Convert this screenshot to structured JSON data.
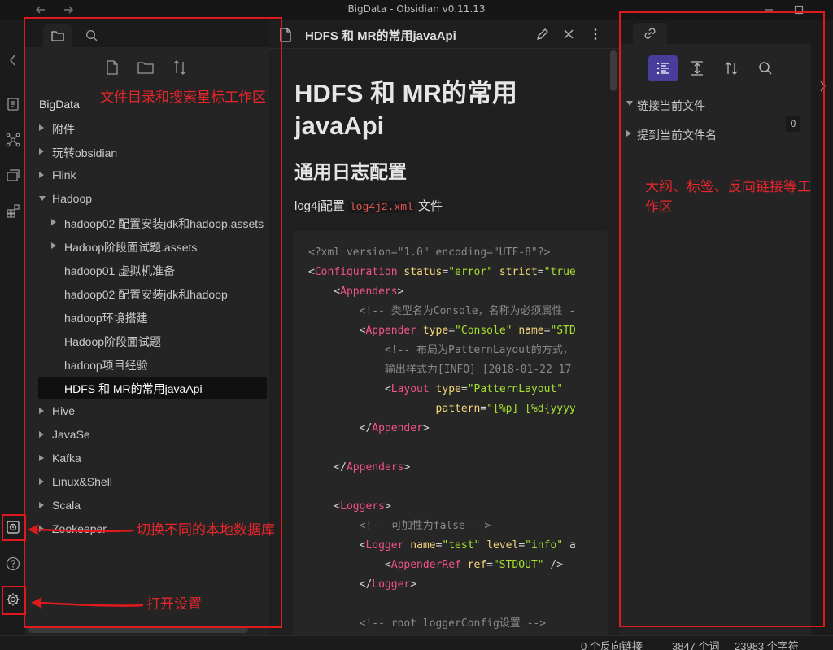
{
  "window": {
    "title": "BigData - Obsidian v0.11.13"
  },
  "vault": {
    "name": "BigData"
  },
  "file_tree": [
    {
      "label": "附件",
      "level": 0,
      "kind": "folder-closed"
    },
    {
      "label": "玩转obsidian",
      "level": 0,
      "kind": "folder-closed"
    },
    {
      "label": "Flink",
      "level": 0,
      "kind": "folder-closed"
    },
    {
      "label": "Hadoop",
      "level": 0,
      "kind": "folder-open"
    },
    {
      "label": "hadoop02 配置安装jdk和hadoop.assets",
      "level": 1,
      "kind": "folder-closed"
    },
    {
      "label": "Hadoop阶段面试题.assets",
      "level": 1,
      "kind": "folder-closed"
    },
    {
      "label": "hadoop01 虚拟机准备",
      "level": 1,
      "kind": "file"
    },
    {
      "label": "hadoop02 配置安装jdk和hadoop",
      "level": 1,
      "kind": "file"
    },
    {
      "label": "hadoop环境搭建",
      "level": 1,
      "kind": "file"
    },
    {
      "label": "Hadoop阶段面试题",
      "level": 1,
      "kind": "file"
    },
    {
      "label": "hadoop项目经验",
      "level": 1,
      "kind": "file"
    },
    {
      "label": "HDFS 和 MR的常用javaApi",
      "level": 1,
      "kind": "file",
      "active": true
    },
    {
      "label": "Hive",
      "level": 0,
      "kind": "folder-closed"
    },
    {
      "label": "JavaSe",
      "level": 0,
      "kind": "folder-closed"
    },
    {
      "label": "Kafka",
      "level": 0,
      "kind": "folder-closed"
    },
    {
      "label": "Linux&Shell",
      "level": 0,
      "kind": "folder-closed"
    },
    {
      "label": "Scala",
      "level": 0,
      "kind": "folder-closed"
    },
    {
      "label": "Zookeeper",
      "level": 0,
      "kind": "folder-closed"
    }
  ],
  "editor": {
    "tab_title": "HDFS 和 MR的常用javaApi",
    "h1": "HDFS 和 MR的常用javaApi",
    "h2": "通用日志配置",
    "para_before": "log4j配置 ",
    "para_code": "log4j2.xml",
    "para_after": " 文件",
    "code_lines": [
      [
        [
          "cm",
          "<?xml version=\"1.0\" encoding=\"UTF-8\"?>"
        ]
      ],
      [
        [
          "pl",
          "<"
        ],
        [
          "tg",
          "Configuration"
        ],
        [
          "pl",
          " "
        ],
        [
          "at",
          "status"
        ],
        [
          "pl",
          "="
        ],
        [
          "st",
          "\"error\""
        ],
        [
          "pl",
          " "
        ],
        [
          "at",
          "strict"
        ],
        [
          "pl",
          "="
        ],
        [
          "st",
          "\"true"
        ]
      ],
      [
        [
          "pl",
          "    <"
        ],
        [
          "tg",
          "Appenders"
        ],
        [
          "pl",
          ">"
        ]
      ],
      [
        [
          "cm",
          "        <!-- 类型名为Console，名称为必须属性 -"
        ]
      ],
      [
        [
          "pl",
          "        <"
        ],
        [
          "tg",
          "Appender"
        ],
        [
          "pl",
          " "
        ],
        [
          "at",
          "type"
        ],
        [
          "pl",
          "="
        ],
        [
          "st",
          "\"Console\""
        ],
        [
          "pl",
          " "
        ],
        [
          "at",
          "name"
        ],
        [
          "pl",
          "="
        ],
        [
          "st",
          "\"STD"
        ]
      ],
      [
        [
          "cm",
          "            <!-- 布局为PatternLayout的方式，"
        ]
      ],
      [
        [
          "cm",
          "            输出样式为[INFO] [2018-01-22 17"
        ]
      ],
      [
        [
          "pl",
          "            <"
        ],
        [
          "tg",
          "Layout"
        ],
        [
          "pl",
          " "
        ],
        [
          "at",
          "type"
        ],
        [
          "pl",
          "="
        ],
        [
          "st",
          "\"PatternLayout\""
        ]
      ],
      [
        [
          "pl",
          "                    "
        ],
        [
          "at",
          "pattern"
        ],
        [
          "pl",
          "="
        ],
        [
          "st",
          "\"[%p] [%d{yyyy"
        ]
      ],
      [
        [
          "pl",
          "        </"
        ],
        [
          "tg",
          "Appender"
        ],
        [
          "pl",
          ">"
        ]
      ],
      [],
      [
        [
          "pl",
          "    </"
        ],
        [
          "tg",
          "Appenders"
        ],
        [
          "pl",
          ">"
        ]
      ],
      [],
      [
        [
          "pl",
          "    <"
        ],
        [
          "tg",
          "Loggers"
        ],
        [
          "pl",
          ">"
        ]
      ],
      [
        [
          "cm",
          "        <!-- 可加性为false -->"
        ]
      ],
      [
        [
          "pl",
          "        <"
        ],
        [
          "tg",
          "Logger"
        ],
        [
          "pl",
          " "
        ],
        [
          "at",
          "name"
        ],
        [
          "pl",
          "="
        ],
        [
          "st",
          "\"test\""
        ],
        [
          "pl",
          " "
        ],
        [
          "at",
          "level"
        ],
        [
          "pl",
          "="
        ],
        [
          "st",
          "\"info\""
        ],
        [
          "pl",
          " a"
        ]
      ],
      [
        [
          "pl",
          "            <"
        ],
        [
          "tg",
          "AppenderRef"
        ],
        [
          "pl",
          " "
        ],
        [
          "at",
          "ref"
        ],
        [
          "pl",
          "="
        ],
        [
          "st",
          "\"STDOUT\""
        ],
        [
          "pl",
          " />"
        ]
      ],
      [
        [
          "pl",
          "        </"
        ],
        [
          "tg",
          "Logger"
        ],
        [
          "pl",
          ">"
        ]
      ],
      [],
      [
        [
          "cm",
          "        <!-- root loggerConfig设置 -->"
        ]
      ]
    ]
  },
  "right_panel": {
    "linked_mentions": "链接当前文件",
    "linked_count": "0",
    "unlinked_mentions": "提到当前文件名"
  },
  "statusbar": {
    "backlinks": "0 个反向链接",
    "words": "3847 个词",
    "chars": "23983 个字符"
  },
  "annotations": {
    "file_area": "文件目录和搜索星标工作区",
    "right_area": "大纲、标签、反向链接等工作区",
    "switch_vault": "切换不同的本地数据库",
    "open_settings": "打开设置"
  },
  "icons": {
    "nav_back": "arrow-left-icon",
    "nav_forward": "arrow-right-icon",
    "settings": "gear-icon",
    "help": "help-icon",
    "vault": "vault-icon"
  },
  "colors": {
    "accent": "#483d99",
    "annotation": "#e0191e",
    "code_tag": "#f55385",
    "code_attr": "#f5d77a",
    "code_string": "#a6e22e",
    "inline_code": "#eb5757"
  }
}
